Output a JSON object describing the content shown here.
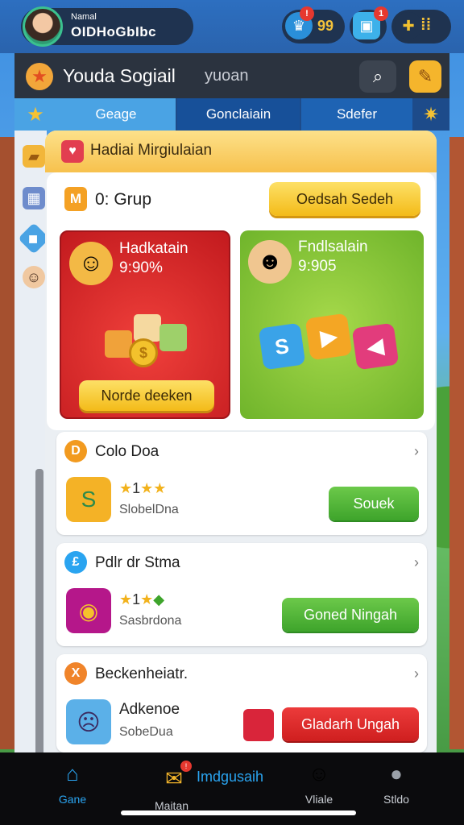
{
  "user": {
    "label": "Namal",
    "id": "OIDHoGbIbc"
  },
  "stats": [
    {
      "icon": "trophy-icon",
      "value": "99",
      "badge": ""
    },
    {
      "icon": "gift-box-icon",
      "value": "",
      "badge": "1"
    },
    {
      "icon": "puzzle-icon",
      "value": ""
    }
  ],
  "titlebar": {
    "title": "Youda Sogiail",
    "sub": "yuoan"
  },
  "tabs": [
    "Geage",
    "Gonclaiain",
    "Sdefer"
  ],
  "panel": {
    "header_title": "Hadiai Mirgiulaian",
    "group": {
      "label": "0: Grup",
      "button": "Oedsah Sedeh"
    },
    "promos": [
      {
        "title": "Hadkatain",
        "value": "9:90%",
        "button": "Norde deeken"
      },
      {
        "title": "Fndlsalain",
        "value": "9:905"
      }
    ],
    "games": [
      {
        "badge": "D",
        "title": "Colo Doa",
        "rating": "1",
        "sub": "SlobelDna",
        "button": "Souek"
      },
      {
        "badge": "£",
        "title": "Pdlr dr Stma",
        "rating": "1",
        "sub": "Sasbrdona",
        "button": "Goned Ningah"
      },
      {
        "badge": "X",
        "title": "Beckenheiatr.",
        "name": "Adkenoe",
        "sub": "SobeDua",
        "button": "Gladarh Ungah"
      }
    ]
  },
  "nav": {
    "home": "Gane",
    "messages_title": "Imdgusaih",
    "messages": "Maitan",
    "friends": "Vliale",
    "profile": "Stldo"
  },
  "colors": {
    "accent_blue": "#2aa4f0",
    "accent_yellow": "#f3bb19",
    "green_btn": "#3ea42b",
    "red_btn": "#cf1f1f"
  }
}
